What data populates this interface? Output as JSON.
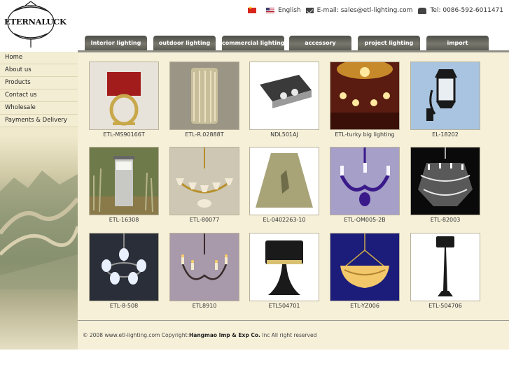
{
  "logo": {
    "text": "ETERNALUCK"
  },
  "topbar": {
    "language": "English",
    "email": "E-mail: sales@etl-lighting.com",
    "tel": "Tel: 0086-592-6011471"
  },
  "nav": [
    {
      "label": "Interior lighting"
    },
    {
      "label": "outdoor lighting"
    },
    {
      "label": "commercial lighting"
    },
    {
      "label": "accessory"
    },
    {
      "label": "project lighting"
    },
    {
      "label": "import"
    }
  ],
  "sidebar": [
    {
      "label": "Home"
    },
    {
      "label": "About us"
    },
    {
      "label": "Products"
    },
    {
      "label": "Contact us"
    },
    {
      "label": "Wholesale"
    },
    {
      "label": "Payments & Delivery"
    }
  ],
  "products": [
    {
      "name": "ETL-MS90166T",
      "icon": "table-lamp-icon"
    },
    {
      "name": "ETL-R.02888T",
      "icon": "crystal-wall-lamp-icon"
    },
    {
      "name": "NDL501AJ",
      "icon": "ceiling-spotlight-icon"
    },
    {
      "name": "ETL-turky big lighting",
      "icon": "theater-lighting-icon"
    },
    {
      "name": "EL-18202",
      "icon": "wall-lantern-icon"
    },
    {
      "name": "ETL-16308",
      "icon": "garden-bollard-icon"
    },
    {
      "name": "ETL-80077",
      "icon": "chandelier-icon"
    },
    {
      "name": "EL-0402263-10",
      "icon": "lamp-shade-icon"
    },
    {
      "name": "ETL-OM005-2B",
      "icon": "glass-chandelier-icon"
    },
    {
      "name": "ETL-82003",
      "icon": "crystal-chandelier-icon"
    },
    {
      "name": "ETL-8-508",
      "icon": "pendant-chandelier-icon"
    },
    {
      "name": "ETL8910",
      "icon": "candle-chandelier-icon"
    },
    {
      "name": "ETL504701",
      "icon": "black-table-lamp-icon"
    },
    {
      "name": "ETL-YZ006",
      "icon": "bowl-pendant-icon"
    },
    {
      "name": "ETL-504706",
      "icon": "floor-lamp-icon"
    }
  ],
  "footer": {
    "prefix": "© 2008 www.etl-lighting.com Copyright:",
    "company": "Hangmao Imp & Exp Co.",
    "suffix": " Inc All right reserved"
  }
}
